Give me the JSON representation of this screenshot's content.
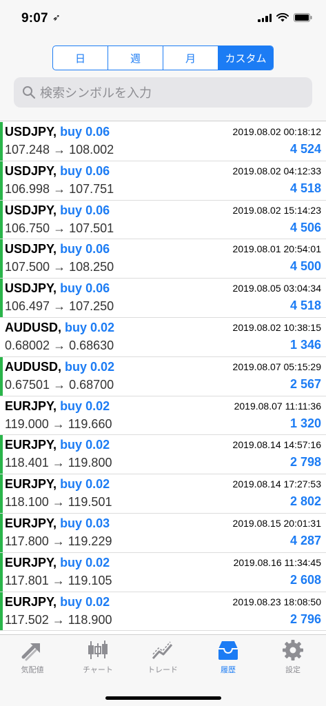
{
  "status": {
    "time": "9:07",
    "location_glyph": "➶"
  },
  "segments": [
    {
      "label": "日",
      "active": false
    },
    {
      "label": "週",
      "active": false
    },
    {
      "label": "月",
      "active": false
    },
    {
      "label": "カスタム",
      "active": true
    }
  ],
  "search": {
    "placeholder": "検索シンボルを入力"
  },
  "rows": [
    {
      "symbol": "USDJPY,",
      "side": "buy 0.06",
      "prices": "107.248 → 108.002",
      "datetime": "2019.08.02 00:18:12",
      "profit": "4 524",
      "marker": true
    },
    {
      "symbol": "USDJPY,",
      "side": "buy 0.06",
      "prices": "106.998 → 107.751",
      "datetime": "2019.08.02 04:12:33",
      "profit": "4 518",
      "marker": true
    },
    {
      "symbol": "USDJPY,",
      "side": "buy 0.06",
      "prices": "106.750 → 107.501",
      "datetime": "2019.08.02 15:14:23",
      "profit": "4 506",
      "marker": true
    },
    {
      "symbol": "USDJPY,",
      "side": "buy 0.06",
      "prices": "107.500 → 108.250",
      "datetime": "2019.08.01 20:54:01",
      "profit": "4 500",
      "marker": true
    },
    {
      "symbol": "USDJPY,",
      "side": "buy 0.06",
      "prices": "106.497 → 107.250",
      "datetime": "2019.08.05 03:04:34",
      "profit": "4 518",
      "marker": true
    },
    {
      "symbol": "AUDUSD,",
      "side": "buy 0.02",
      "prices": "0.68002 → 0.68630",
      "datetime": "2019.08.02 10:38:15",
      "profit": "1 346",
      "marker": false
    },
    {
      "symbol": "AUDUSD,",
      "side": "buy 0.02",
      "prices": "0.67501 → 0.68700",
      "datetime": "2019.08.07 05:15:29",
      "profit": "2 567",
      "marker": true
    },
    {
      "symbol": "EURJPY,",
      "side": "buy 0.02",
      "prices": "119.000 → 119.660",
      "datetime": "2019.08.07 11:11:36",
      "profit": "1 320",
      "marker": false
    },
    {
      "symbol": "EURJPY,",
      "side": "buy 0.02",
      "prices": "118.401 → 119.800",
      "datetime": "2019.08.14 14:57:16",
      "profit": "2 798",
      "marker": true
    },
    {
      "symbol": "EURJPY,",
      "side": "buy 0.02",
      "prices": "118.100 → 119.501",
      "datetime": "2019.08.14 17:27:53",
      "profit": "2 802",
      "marker": true
    },
    {
      "symbol": "EURJPY,",
      "side": "buy 0.03",
      "prices": "117.800 → 119.229",
      "datetime": "2019.08.15 20:01:31",
      "profit": "4 287",
      "marker": true
    },
    {
      "symbol": "EURJPY,",
      "side": "buy 0.02",
      "prices": "117.801 → 119.105",
      "datetime": "2019.08.16 11:34:45",
      "profit": "2 608",
      "marker": true
    },
    {
      "symbol": "EURJPY,",
      "side": "buy 0.02",
      "prices": "117.502 → 118.900",
      "datetime": "2019.08.23 18:08:50",
      "profit": "2 796",
      "marker": true
    }
  ],
  "tabs": [
    {
      "label": "気配値",
      "icon": "quotes-icon",
      "active": false
    },
    {
      "label": "チャート",
      "icon": "chart-icon",
      "active": false
    },
    {
      "label": "トレード",
      "icon": "trade-icon",
      "active": false
    },
    {
      "label": "履歴",
      "icon": "history-icon",
      "active": true
    },
    {
      "label": "設定",
      "icon": "gear-icon",
      "active": false
    }
  ],
  "colors": {
    "accent": "#1c7cf4",
    "profit_marker": "#2ab44a",
    "inactive_tab": "#8e8e93"
  }
}
